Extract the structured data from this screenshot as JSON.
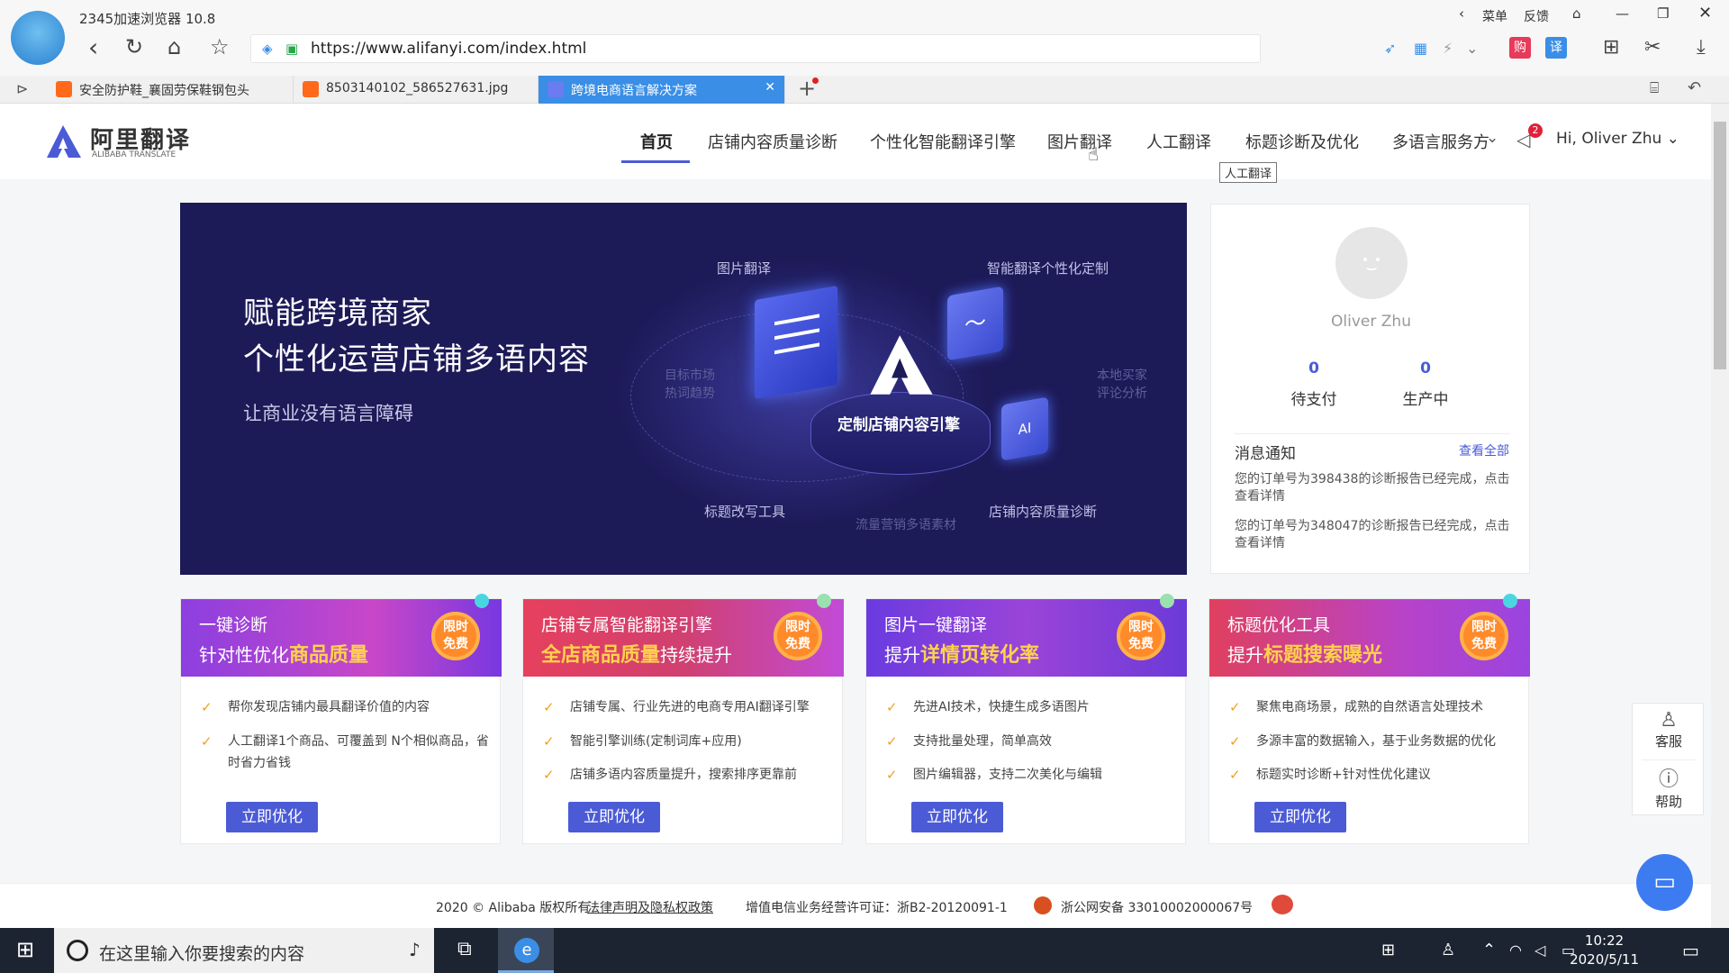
{
  "browser": {
    "title": "2345加速浏览器 10.8",
    "menu_label": "菜单",
    "feedback_label": "反馈",
    "url": "https://www.alifanyi.com/index.html",
    "tabs": [
      {
        "label": "安全防护鞋_襄固劳保鞋钢包头"
      },
      {
        "label": "8503140102_586527631.jpg"
      },
      {
        "label": "跨境电商语言解决方案"
      }
    ]
  },
  "site": {
    "logo_cn": "阿里翻译",
    "logo_en": "ALIBABA TRANSLATE",
    "nav": [
      "首页",
      "店铺内容质量诊断",
      "个性化智能翻译引擎",
      "图片翻译",
      "人工翻译",
      "标题诊断及优化",
      "多语言服务方"
    ],
    "notification_count": "2",
    "user_greeting": "Hi, Oliver Zhu",
    "tooltip": "人工翻译"
  },
  "banner": {
    "title1": "赋能跨境商家",
    "title2": "个性化运营店铺多语内容",
    "subtitle": "让商业没有语言障碍",
    "labels": {
      "image_translation": "图片翻译",
      "smart_custom": "智能翻译个性化定制",
      "target_market": "目标市场",
      "hot_words": "热词趋势",
      "local_buyer": "本地买家",
      "review_analysis": "评论分析",
      "center": "定制店铺内容引擎",
      "title_tool": "标题改写工具",
      "store_diagnosis": "店铺内容质量诊断",
      "traffic": "流量营销多语素材"
    }
  },
  "user": {
    "name": "Oliver Zhu",
    "pending_pay_count": "0",
    "pending_pay_label": "待支付",
    "producing_count": "0",
    "producing_label": "生产中",
    "msg_title": "消息通知",
    "msg_all": "查看全部",
    "messages": [
      "您的订单号为398438的诊断报告已经完成，点击查看详情",
      "您的订单号为348047的诊断报告已经完成，点击查看详情"
    ]
  },
  "cards": [
    {
      "line1": "一键诊断",
      "line2_pre": "针对性优化",
      "line2_hl": "商品质量",
      "line2_post": "",
      "badge": "限时免费",
      "features": [
        "帮你发现店铺内最具翻译价值的内容",
        "人工翻译1个商品、可覆盖到 N个相似商品，省时省力省钱"
      ],
      "button": "立即优化"
    },
    {
      "line1": "店铺专属智能翻译引擎",
      "line2_pre": "",
      "line2_hl": "全店商品质量",
      "line2_post": "持续提升",
      "badge": "限时免费",
      "features": [
        "店铺专属、行业先进的电商专用AI翻译引擎",
        "智能引擎训练(定制词库+应用)",
        "店铺多语内容质量提升，搜索排序更靠前"
      ],
      "button": "立即优化"
    },
    {
      "line1": "图片一键翻译",
      "line2_pre": "提升",
      "line2_hl": "详情页转化率",
      "line2_post": "",
      "badge": "限时免费",
      "features": [
        "先进AI技术，快捷生成多语图片",
        "支持批量处理，简单高效",
        "图片编辑器，支持二次美化与编辑"
      ],
      "button": "立即优化"
    },
    {
      "line1": "标题优化工具",
      "line2_pre": "提升",
      "line2_hl": "标题搜索曝光",
      "line2_post": "",
      "badge": "限时免费",
      "features": [
        "聚焦电商场景，成熟的自然语言处理技术",
        "多源丰富的数据输入，基于业务数据的优化",
        "标题实时诊断+针对性优化建议"
      ],
      "button": "立即优化"
    }
  ],
  "footer": {
    "copyright": "2020 © Alibaba 版权所有",
    "legal": "法律声明及隐私权政策",
    "icp": "增值电信业务经营许可证：浙B2-20120091-1",
    "police": "浙公网安备 33010002000067号"
  },
  "side": {
    "service": "客服",
    "help": "帮助"
  },
  "taskbar": {
    "search_placeholder": "在这里输入你要搜索的内容",
    "time": "10:22",
    "date": "2020/5/11"
  },
  "colors": {
    "brand": "#4b5bd6",
    "banner_bg": "#1d1a58",
    "badge": "#ff8a2a"
  }
}
